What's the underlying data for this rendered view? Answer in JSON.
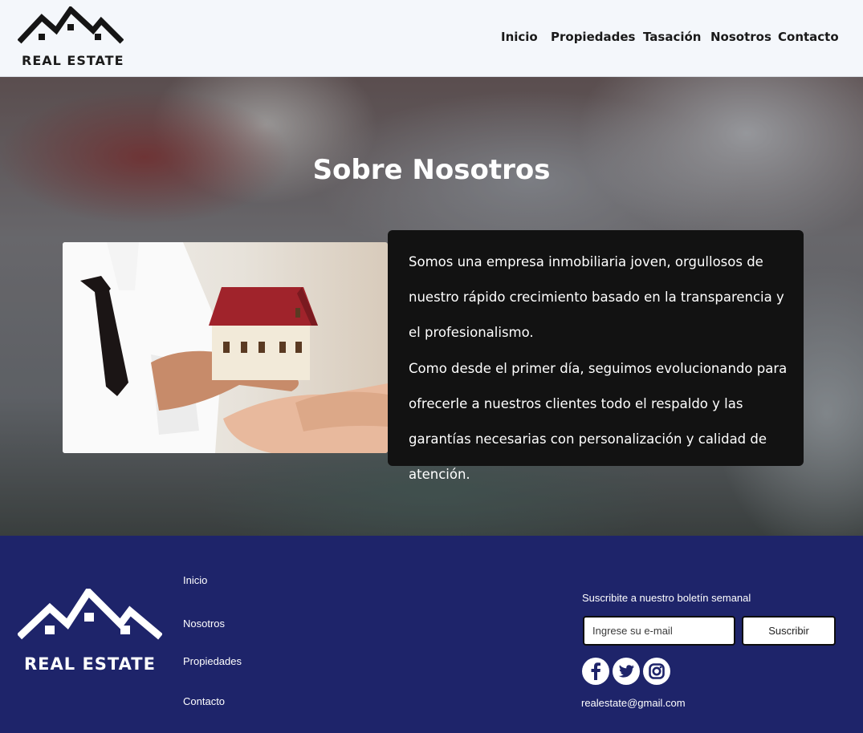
{
  "header": {
    "logo_text": "REAL ESTATE",
    "nav": [
      "Inicio",
      "Propiedades",
      "Tasación",
      "Nosotros",
      "Contacto"
    ]
  },
  "hero": {
    "title": "Sobre Nosotros",
    "paragraph_1": "Somos una empresa inmobiliaria joven, orgullosos de nuestro rápido crecimiento basado en la transparencia y el profesionalismo.",
    "paragraph_2": "Como desde el primer día, seguimos evolucionando para ofrecerle a nuestros clientes todo el respaldo y las garantías necesarias con personalización y calidad de atención."
  },
  "footer": {
    "logo_text": "REAL ESTATE",
    "links": [
      "Inicio",
      "Nosotros",
      "Propiedades",
      "Contacto"
    ],
    "newsletter_label": "Suscribite a nuestro boletín semanal",
    "email_placeholder": "Ingrese su e-mail",
    "subscribe_label": "Suscribir",
    "social": [
      "facebook-icon",
      "twitter-icon",
      "instagram-icon"
    ],
    "contact_email": "realestate@gmail.com"
  },
  "colors": {
    "header_bg": "#f4f7fb",
    "footer_bg": "#1e246a",
    "card_bg": "#121212"
  }
}
